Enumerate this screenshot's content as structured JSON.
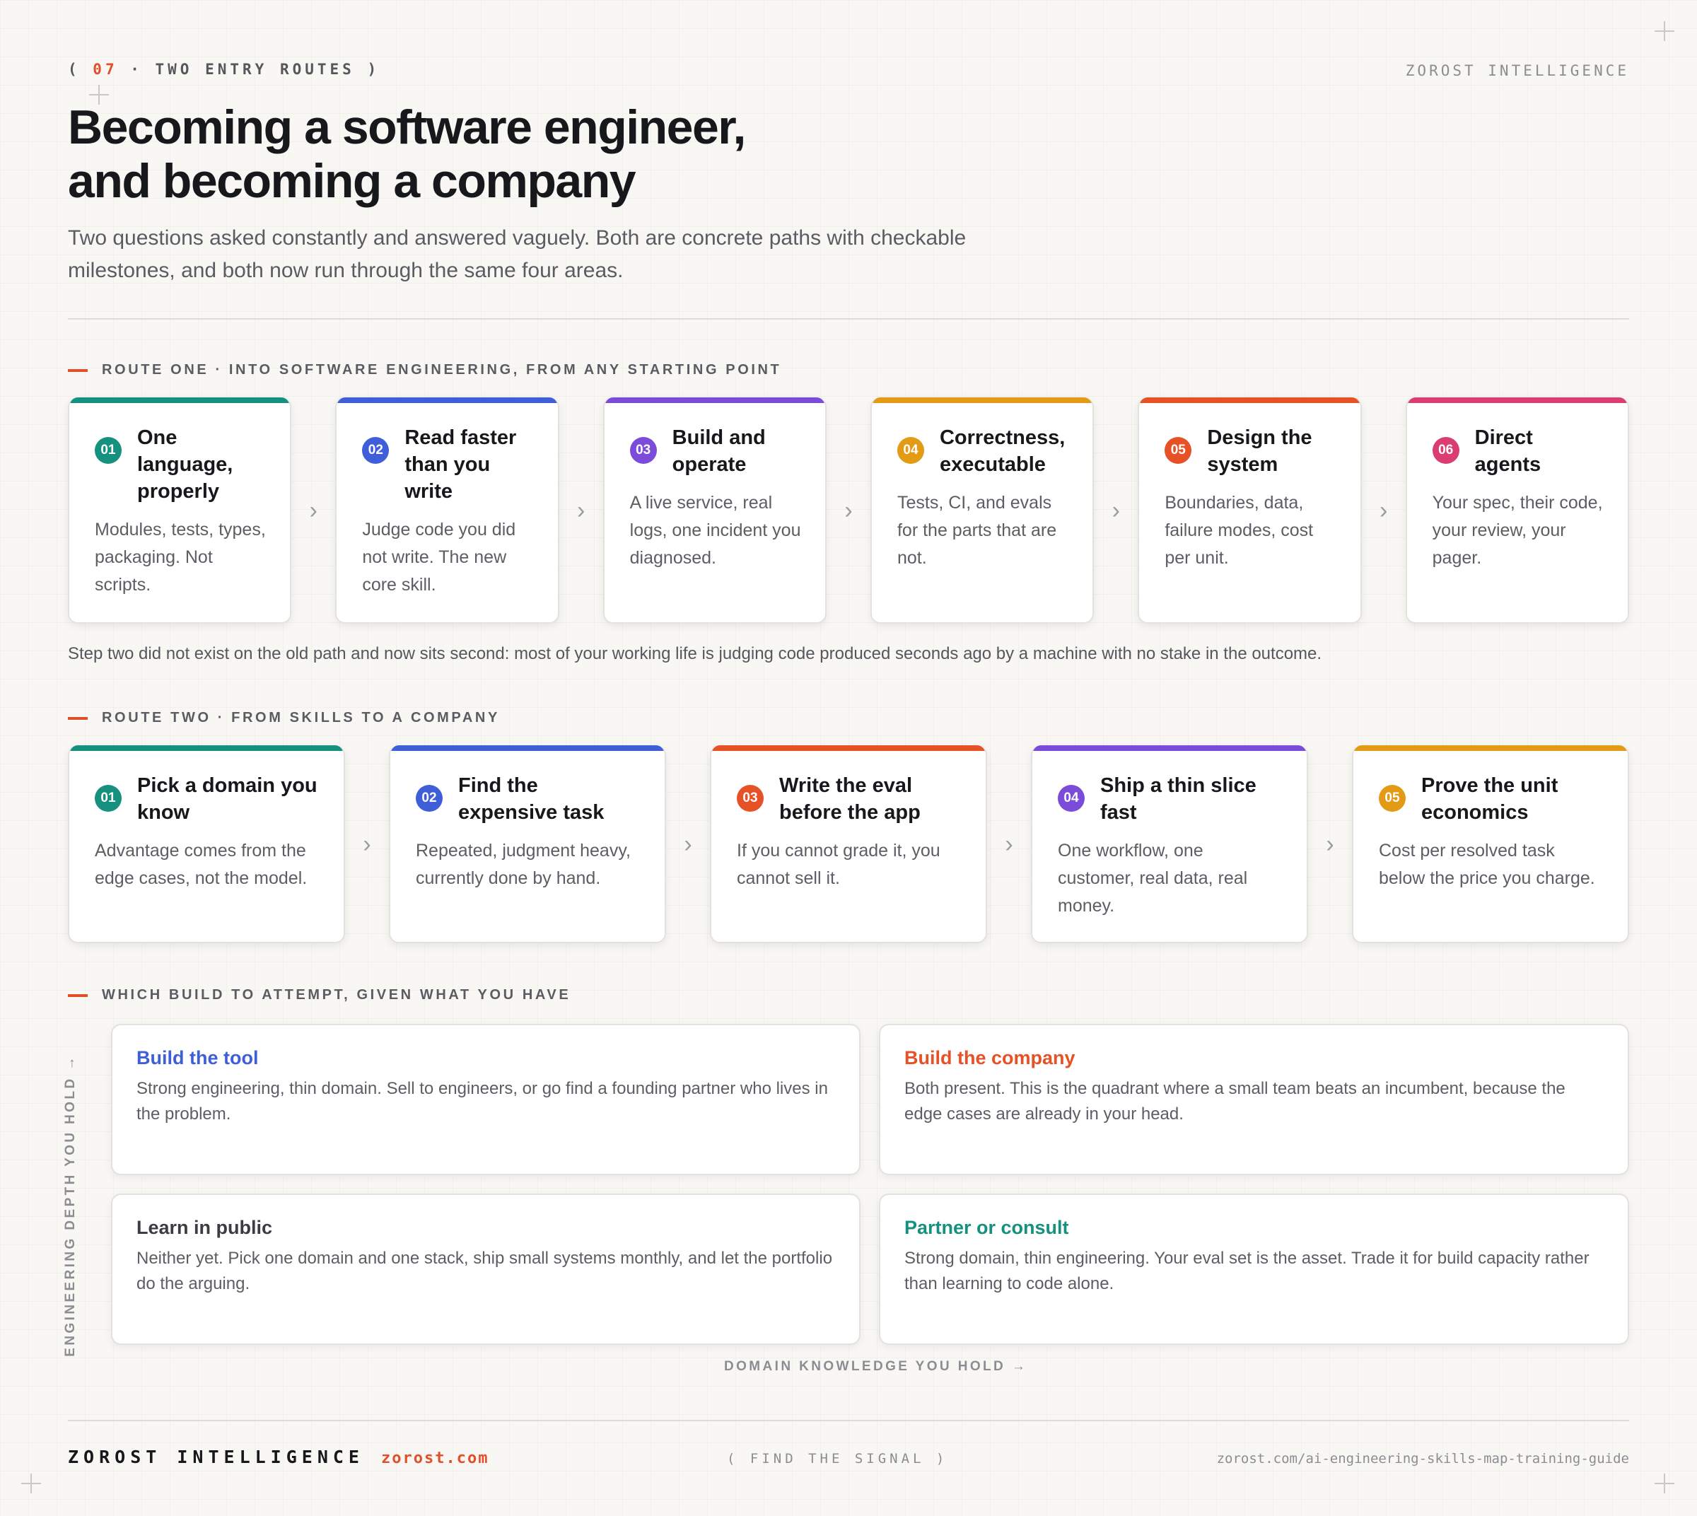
{
  "header": {
    "kicker_open": "( ",
    "kicker_number": "07",
    "kicker_text": " · TWO ENTRY ROUTES )",
    "brand": "ZOROST INTELLIGENCE"
  },
  "title": {
    "line1": "Becoming a software engineer,",
    "line2": "and becoming a company"
  },
  "subtitle": "Two questions asked constantly and answered vaguely. Both are concrete paths with checkable milestones, and both now run through the same four areas.",
  "colors": {
    "teal": "#16907f",
    "blue": "#3f5fd9",
    "purple": "#7a4cd9",
    "amber": "#e39a14",
    "orange": "#e65125",
    "pink": "#d93d72",
    "accent": "#e0502a"
  },
  "route_one": {
    "label": "ROUTE ONE · INTO SOFTWARE ENGINEERING, FROM ANY STARTING POINT",
    "arrow_icon": "chevron-right-icon",
    "steps": [
      {
        "num": "01",
        "title": "One language, properly",
        "desc": "Modules, tests, types, packaging. Not scripts.",
        "color": "#16907f"
      },
      {
        "num": "02",
        "title": "Read faster than you write",
        "desc": "Judge code you did not write. The new core skill.",
        "color": "#3f5fd9"
      },
      {
        "num": "03",
        "title": "Build and operate",
        "desc": "A live service, real logs, one incident you diagnosed.",
        "color": "#7a4cd9"
      },
      {
        "num": "04",
        "title": "Correctness, executable",
        "desc": "Tests, CI, and evals for the parts that are not.",
        "color": "#e39a14"
      },
      {
        "num": "05",
        "title": "Design the system",
        "desc": "Boundaries, data, failure modes, cost per unit.",
        "color": "#e65125"
      },
      {
        "num": "06",
        "title": "Direct agents",
        "desc": "Your spec, their code, your review, your pager.",
        "color": "#d93d72"
      }
    ],
    "note": "Step two did not exist on the old path and now sits second: most of your working life is judging code produced seconds ago by a machine with no stake in the outcome."
  },
  "route_two": {
    "label": "ROUTE TWO · FROM SKILLS TO A COMPANY",
    "steps": [
      {
        "num": "01",
        "title": "Pick a domain you know",
        "desc": "Advantage comes from the edge cases, not the model.",
        "color": "#16907f"
      },
      {
        "num": "02",
        "title": "Find the expensive task",
        "desc": "Repeated, judgment heavy, currently done by hand.",
        "color": "#3f5fd9"
      },
      {
        "num": "03",
        "title": "Write the eval before the app",
        "desc": "If you cannot grade it, you cannot sell it.",
        "color": "#e65125"
      },
      {
        "num": "04",
        "title": "Ship a thin slice fast",
        "desc": "One workflow, one customer, real data, real money.",
        "color": "#7a4cd9"
      },
      {
        "num": "05",
        "title": "Prove the unit economics",
        "desc": "Cost per resolved task below the price you charge.",
        "color": "#e39a14"
      }
    ]
  },
  "matrix": {
    "label": "WHICH BUILD TO ATTEMPT, GIVEN WHAT YOU HAVE",
    "y_axis": "ENGINEERING DEPTH YOU HOLD →",
    "x_axis": "DOMAIN KNOWLEDGE YOU HOLD →",
    "quadrants": {
      "top_left": {
        "title": "Build the tool",
        "desc": "Strong engineering, thin domain. Sell to engineers, or go find a founding partner who lives in the problem.",
        "color": "#3f5fd9"
      },
      "top_right": {
        "title": "Build the company",
        "desc": "Both present. This is the quadrant where a small team beats an incumbent, because the edge cases are already in your head.",
        "color": "#e65125"
      },
      "bottom_left": {
        "title": "Learn in public",
        "desc": "Neither yet. Pick one domain and one stack, ship small systems monthly, and let the portfolio do the arguing.",
        "color": "#3b3d42"
      },
      "bottom_right": {
        "title": "Partner or consult",
        "desc": "Strong domain, thin engineering. Your eval set is the asset. Trade it for build capacity rather than learning to code alone.",
        "color": "#16907f"
      }
    }
  },
  "footer": {
    "brand": "ZOROST INTELLIGENCE",
    "site": "zorost.com",
    "tagline": "( FIND THE SIGNAL )",
    "url": "zorost.com/ai-engineering-skills-map-training-guide"
  }
}
